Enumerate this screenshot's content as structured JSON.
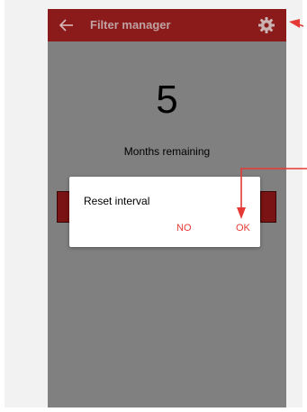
{
  "app_bar": {
    "title": "Filter manager",
    "back_icon": "arrow-left-icon",
    "settings_icon": "gear-icon"
  },
  "counter": {
    "value": "5",
    "label": "Months remaining"
  },
  "dialog": {
    "title": "Reset interval",
    "no_label": "NO",
    "ok_label": "OK"
  },
  "colors": {
    "app_bar": "#8b1a1a",
    "screen_background": "#808080",
    "accent": "#e53935"
  }
}
